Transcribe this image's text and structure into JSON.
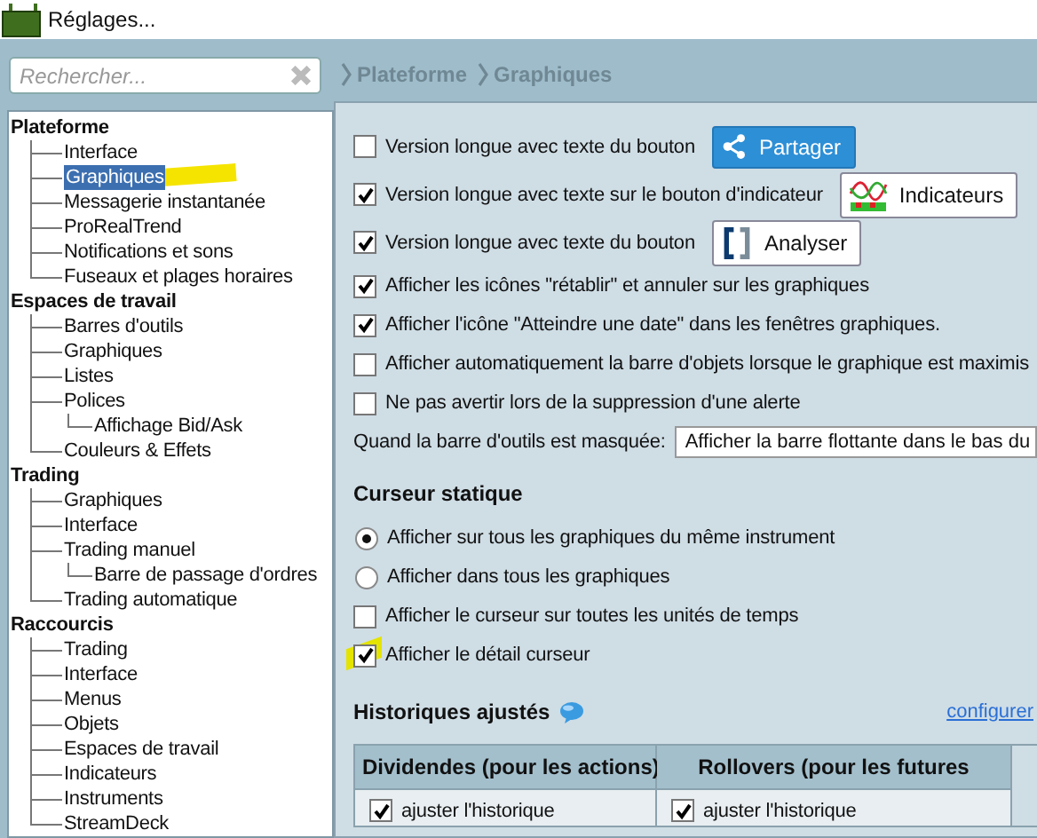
{
  "window": {
    "title": "Réglages..."
  },
  "search": {
    "placeholder": "Rechercher..."
  },
  "tree": [
    {
      "label": "Plateforme",
      "selected": false,
      "children": [
        {
          "label": "Interface",
          "selected": false
        },
        {
          "label": "Graphiques",
          "selected": true
        },
        {
          "label": "Messagerie instantanée",
          "selected": false
        },
        {
          "label": "ProRealTrend",
          "selected": false
        },
        {
          "label": "Notifications et sons",
          "selected": false
        },
        {
          "label": "Fuseaux et plages horaires",
          "selected": false
        }
      ]
    },
    {
      "label": "Espaces de travail",
      "selected": false,
      "children": [
        {
          "label": "Barres d'outils",
          "selected": false
        },
        {
          "label": "Graphiques",
          "selected": false
        },
        {
          "label": "Listes",
          "selected": false
        },
        {
          "label": "Polices",
          "selected": false,
          "children": [
            {
              "label": "Affichage Bid/Ask",
              "selected": false
            }
          ]
        },
        {
          "label": "Couleurs & Effets",
          "selected": false
        }
      ]
    },
    {
      "label": "Trading",
      "selected": false,
      "children": [
        {
          "label": "Graphiques",
          "selected": false
        },
        {
          "label": "Interface",
          "selected": false
        },
        {
          "label": "Trading manuel",
          "selected": false,
          "children": [
            {
              "label": "Barre de passage d'ordres",
              "selected": false
            }
          ]
        },
        {
          "label": "Trading automatique",
          "selected": false
        }
      ]
    },
    {
      "label": "Raccourcis",
      "selected": false,
      "children": [
        {
          "label": "Trading",
          "selected": false
        },
        {
          "label": "Interface",
          "selected": false
        },
        {
          "label": "Menus",
          "selected": false
        },
        {
          "label": "Objets",
          "selected": false
        },
        {
          "label": "Espaces de travail",
          "selected": false
        },
        {
          "label": "Indicateurs",
          "selected": false
        },
        {
          "label": "Instruments",
          "selected": false
        },
        {
          "label": "StreamDeck",
          "selected": false
        }
      ]
    }
  ],
  "breadcrumb": [
    "Plateforme",
    "Graphiques"
  ],
  "options": [
    {
      "kind": "checkbox",
      "label": "Version longue avec texte du bouton",
      "checked": false,
      "button": {
        "kind": "share",
        "label": "Partager"
      }
    },
    {
      "kind": "checkbox",
      "label": "Version longue avec texte sur le bouton d'indicateur",
      "checked": true,
      "button": {
        "kind": "indicator",
        "label": "Indicateurs"
      }
    },
    {
      "kind": "checkbox",
      "label": "Version longue avec texte du bouton",
      "checked": true,
      "button": {
        "kind": "analyse",
        "label": "Analyser"
      }
    },
    {
      "kind": "checkbox",
      "label": "Afficher les icônes \"rétablir\" et annuler sur les graphiques",
      "checked": true
    },
    {
      "kind": "checkbox",
      "label": "Afficher l'icône \"Atteindre une date\" dans les fenêtres graphiques.",
      "checked": true
    },
    {
      "kind": "checkbox",
      "label": "Afficher automatiquement la barre d'objets lorsque le graphique est maximis",
      "checked": false
    },
    {
      "kind": "checkbox",
      "label": "Ne pas avertir lors de la suppression d'une alerte",
      "checked": false
    },
    {
      "kind": "select",
      "label": "Quand la barre d'outils est masquée:",
      "value": "Afficher la barre flottante dans le bas du"
    },
    {
      "kind": "heading",
      "label": "Curseur statique"
    },
    {
      "kind": "radio",
      "label": "Afficher sur tous les graphiques du même instrument",
      "selected": true
    },
    {
      "kind": "radio",
      "label": "Afficher dans tous les graphiques",
      "selected": false
    },
    {
      "kind": "checkbox",
      "label": "Afficher le curseur sur toutes les unités de temps",
      "checked": false
    },
    {
      "kind": "checkbox",
      "label": "Afficher le détail curseur",
      "checked": true,
      "highlighted": true
    }
  ],
  "historiques": {
    "title": "Historiques ajustés",
    "link": "configurer",
    "columns": [
      "Dividendes (pour les actions)",
      "Rollovers (pour les futures"
    ],
    "cells": [
      {
        "label": "ajuster l'historique",
        "checked": true
      },
      {
        "label": "ajuster l'historique",
        "checked": true
      }
    ]
  }
}
